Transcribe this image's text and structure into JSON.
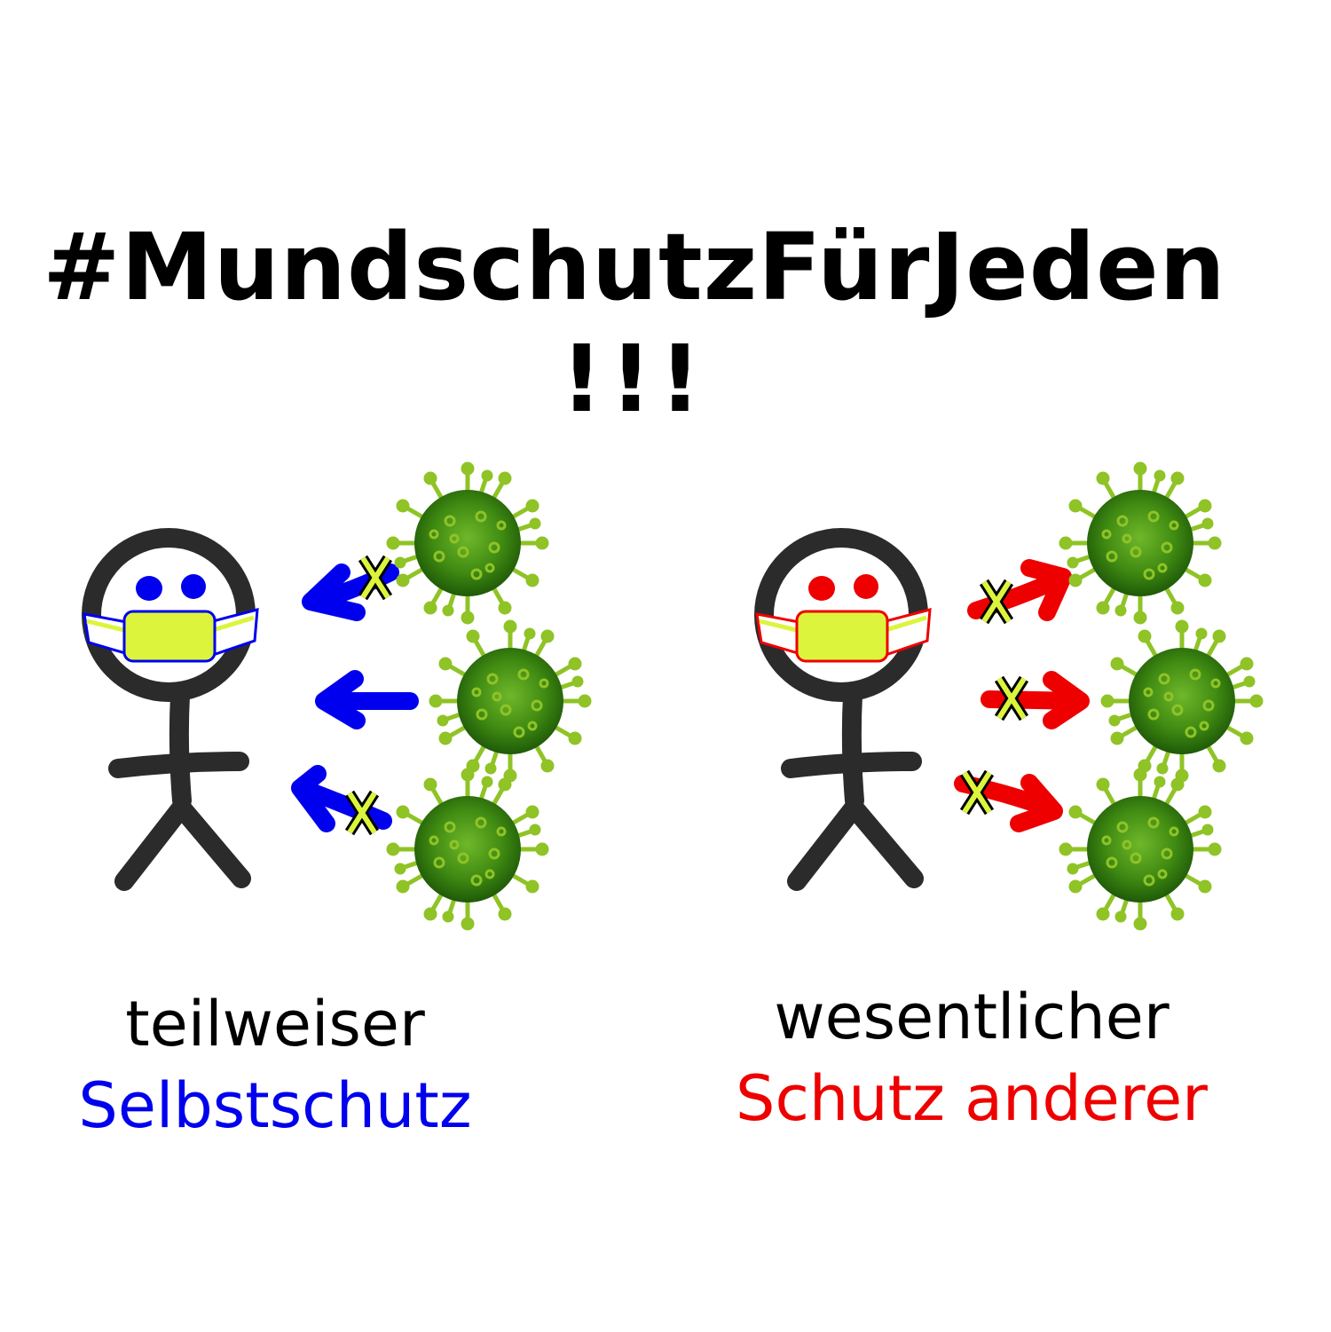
{
  "title": {
    "line1": "#MundschutzFürJeden",
    "line2": "!!!"
  },
  "panels": {
    "left": {
      "caption_line1": "teilweiser",
      "caption_line2": "Selbstschutz",
      "accent_color": "#0000ee",
      "arrows_toward_person": true,
      "arrows_blocked_count": 2,
      "arrows_passing_count": 1
    },
    "right": {
      "caption_line1": "wesentlicher",
      "caption_line2": "Schutz anderer",
      "accent_color": "#ee0000",
      "arrows_toward_person": false,
      "arrows_blocked_count": 3,
      "arrows_passing_count": 0
    }
  },
  "colors": {
    "figure": "#2b2b2b",
    "mask": "#dcf53c",
    "virus": "#3f8a12",
    "virus_spike": "#8fc326",
    "cross": "#dcf53c"
  },
  "icons": [
    "stick-figure-icon",
    "face-mask-icon",
    "coronavirus-icon",
    "arrow-icon",
    "blocked-cross-icon"
  ]
}
